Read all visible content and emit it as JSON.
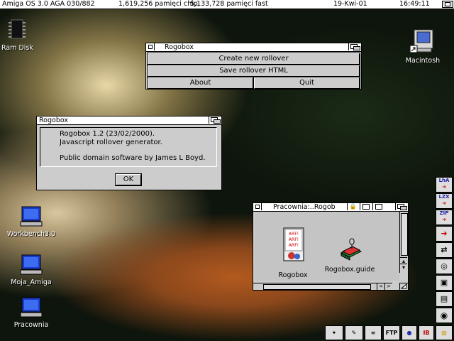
{
  "screen": {
    "title": "Amiga OS 3.0 AGA 030/882",
    "chip_mem": "1,619,256 pamięci chip,",
    "fast_mem": "5,133,728 pamięci fast",
    "date": "19-Kwi-01",
    "time": "16:49:11"
  },
  "desktop_icons": {
    "ram_disk": "Ram Disk",
    "macintosh": "Macintosh",
    "workbench": "Workbench3.0",
    "moja_amiga": "Moja_Amiga",
    "pracownia": "Pracownia"
  },
  "menu_window": {
    "title": "Rogobox",
    "create_label": "Create new rollover",
    "save_label": "Save rollover HTML",
    "about_label": "About",
    "quit_label": "Quit"
  },
  "about_window": {
    "title": "Rogobox",
    "line1": "Rogobox 1.2 (23/02/2000).",
    "line2": "Javascript rollover generator.",
    "line3": "Public domain software by James L Boyd.",
    "ok_label": "OK"
  },
  "drawer_window": {
    "title": "Pracownia:..Rogob",
    "icons": [
      {
        "label": "Rogobox",
        "art_text": "ARF! ARF! ARF!"
      },
      {
        "label": "Rogobox.guide"
      }
    ]
  },
  "toolbar": {
    "lha": "LhA",
    "lzx": "LZX",
    "zip": "ZIP",
    "ftp": "FTP"
  },
  "colors": {
    "window_bg": "#cccccc",
    "title_bg": "#ffffff",
    "monitor_blue": "#1a3cc8"
  }
}
